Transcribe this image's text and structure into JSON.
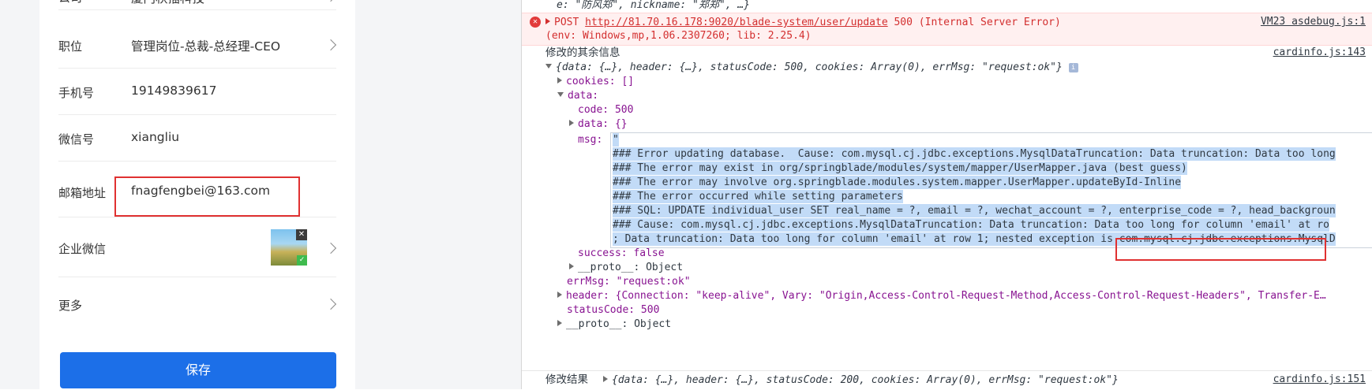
{
  "form": {
    "rows": [
      {
        "label": "公司",
        "value": "厦门秋插科技"
      },
      {
        "label": "职位",
        "value": "管理岗位-总裁-总经理-CEO"
      },
      {
        "label": "手机号",
        "value": "19149839617"
      },
      {
        "label": "微信号",
        "value": "xiangliu"
      },
      {
        "label": "邮箱地址",
        "value": "fnagfengbei@163.com"
      },
      {
        "label": "企业微信",
        "value": ""
      },
      {
        "label": "更多",
        "value": ""
      }
    ],
    "save_label": "保存"
  },
  "console": {
    "line0": "e: \"防风郑\", nickname: \"郑郑\", …}",
    "error": {
      "method": "POST",
      "url": "http://81.70.16.178:9020/blade-system/user/update",
      "status": "500 (Internal Server Error)",
      "env": "(env: Windows,mp,1.06.2307260; lib: 2.25.4)",
      "source": "VM23 asdebug.js:1"
    },
    "log1": {
      "label": "修改的其余信息",
      "source": "cardinfo.js:143",
      "summary": "{data: {…}, header: {…}, statusCode: 500, cookies: Array(0), errMsg: \"request:ok\"}"
    },
    "cookies": "cookies: []",
    "data_key": "data:",
    "code_line": "code: 500",
    "data_inner": "data: {}",
    "msg_key": "msg:",
    "msg_quote": "\"",
    "msg_lines": [
      "### Error updating database.  Cause: com.mysql.cj.jdbc.exceptions.MysqlDataTruncation: Data truncation: Data too long",
      "### The error may exist in org/springblade/modules/system/mapper/UserMapper.java (best guess)",
      "### The error may involve org.springblade.modules.system.mapper.UserMapper.updateById-Inline",
      "### The error occurred while setting parameters",
      "### SQL: UPDATE individual_user SET real_name = ?, email = ?, wechat_account = ?, enterprise_code = ?, head_backgroun",
      "### Cause: com.mysql.cj.jdbc.exceptions.MysqlDataTruncation: Data truncation: Data too long for column 'email' at ro",
      "; Data truncation: Data too long for column 'email' at row 1; nested exception is com.mysql.cj.jdbc.exceptions.MysqlD"
    ],
    "success_line": "success: false",
    "proto1": "__proto__: Object",
    "errmsg_line": "errMsg: \"request:ok\"",
    "header_line": "header: {Connection: \"keep-alive\", Vary: \"Origin,Access-Control-Request-Method,Access-Control-Request-Headers\", Transfer-E…",
    "status_line": "statusCode: 500",
    "proto2": "__proto__: Object",
    "log2": {
      "label": "修改结果",
      "source": "cardinfo.js:151",
      "summary": "{data: {…}, header: {…}, statusCode: 200, cookies: Array(0), errMsg: \"request:ok\"}"
    }
  }
}
